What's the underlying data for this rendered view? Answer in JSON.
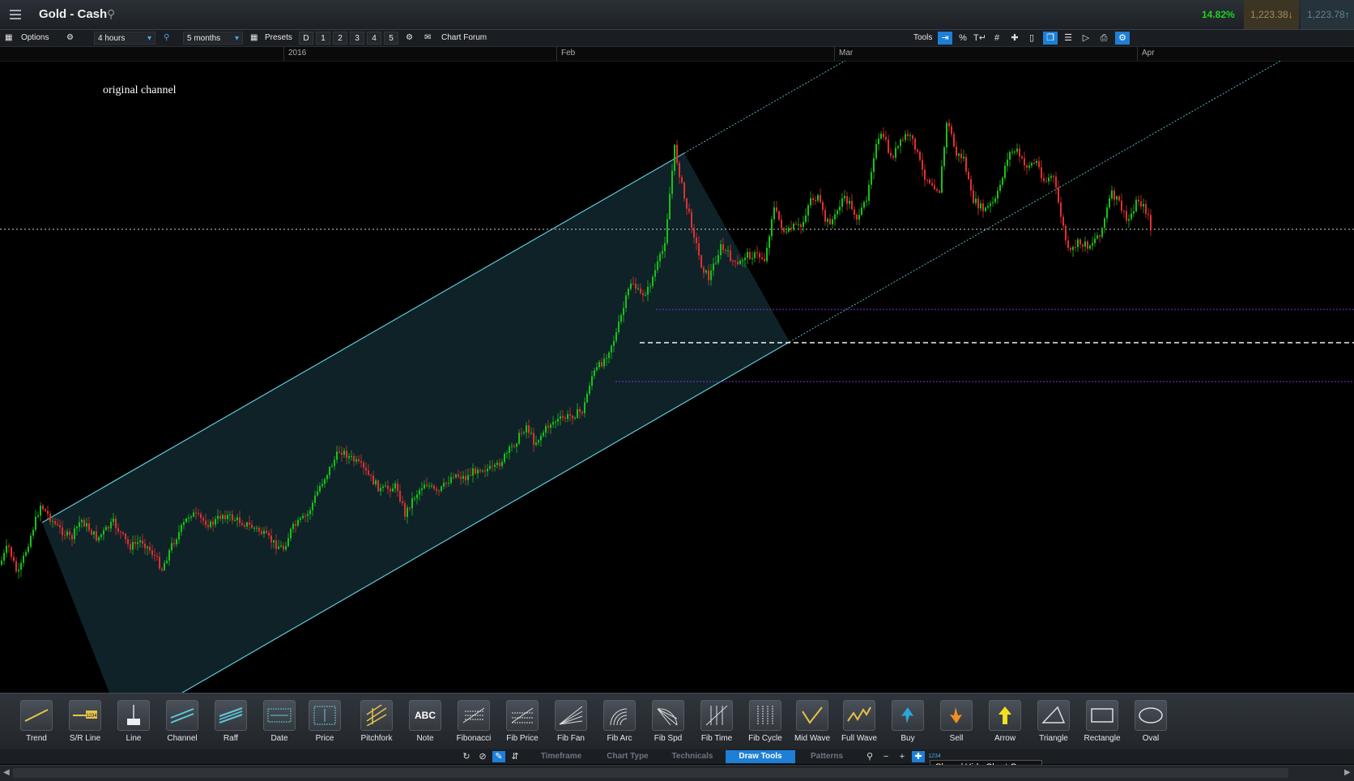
{
  "header": {
    "title": "Gold - Cash",
    "change_pct": "14.82%",
    "sell_price": "1,223.38",
    "buy_price": "1,223.78"
  },
  "toolbar": {
    "options_label": "Options",
    "interval": "4 hours",
    "range": "5 months",
    "presets_label": "Presets",
    "presets": [
      "D",
      "1",
      "2",
      "3",
      "4",
      "5"
    ],
    "chart_forum_label": "Chart Forum",
    "tools_label": "Tools",
    "tool_icons": [
      "cursor-arrow-icon",
      "percent-icon",
      "text-size-icon",
      "grid-icon",
      "crosshair-icon",
      "candle-icon",
      "window-icon",
      "bars-icon",
      "tag-icon",
      "print-icon",
      "settings-icon"
    ]
  },
  "date_axis": {
    "labels": [
      "2016",
      "Feb",
      "Mar",
      "Apr"
    ]
  },
  "annotation": "original channel",
  "draw_tools": [
    {
      "label": "Trend",
      "icon": "trend-line-icon"
    },
    {
      "label": "S/R Line",
      "icon": "sr-line-icon"
    },
    {
      "label": "Line",
      "icon": "vertical-line-icon"
    },
    {
      "label": "Channel",
      "icon": "channel-icon"
    },
    {
      "label": "Raff",
      "icon": "raff-icon"
    },
    {
      "label": "Date",
      "icon": "date-range-icon"
    },
    {
      "label": "Price",
      "icon": "price-range-icon"
    },
    {
      "label": "Pitchfork",
      "icon": "pitchfork-icon"
    },
    {
      "label": "Note",
      "icon": "note-icon"
    },
    {
      "label": "Fibonacci",
      "icon": "fibonacci-icon"
    },
    {
      "label": "Fib Price",
      "icon": "fib-price-icon"
    },
    {
      "label": "Fib Fan",
      "icon": "fib-fan-icon"
    },
    {
      "label": "Fib Arc",
      "icon": "fib-arc-icon"
    },
    {
      "label": "Fib Spd",
      "icon": "fib-speed-icon"
    },
    {
      "label": "Fib Time",
      "icon": "fib-time-icon"
    },
    {
      "label": "Fib Cycle",
      "icon": "fib-cycle-icon"
    },
    {
      "label": "Mid Wave",
      "icon": "mid-wave-icon"
    },
    {
      "label": "Full Wave",
      "icon": "full-wave-icon"
    },
    {
      "label": "Buy",
      "icon": "buy-arrow-icon"
    },
    {
      "label": "Sell",
      "icon": "sell-arrow-icon"
    },
    {
      "label": "Arrow",
      "icon": "arrow-up-icon"
    },
    {
      "label": "Triangle",
      "icon": "triangle-icon"
    },
    {
      "label": "Rectangle",
      "icon": "rectangle-icon"
    },
    {
      "label": "Oval",
      "icon": "oval-icon"
    }
  ],
  "bottom_tabs": [
    {
      "label": "Timeframe",
      "active": false
    },
    {
      "label": "Chart Type",
      "active": false
    },
    {
      "label": "Technicals",
      "active": false
    },
    {
      "label": "Draw Tools",
      "active": true
    },
    {
      "label": "Patterns",
      "active": false
    }
  ],
  "note_icon_text": "ABC",
  "counter_icon_text": "1234",
  "tooltip": "Show / Hide Chart Cursor",
  "colors": {
    "bull_candle": "#19c119",
    "bear_candle": "#e03030",
    "channel_line": "#5ec8d8",
    "support_line": "#8a2be2",
    "active_blue": "#1d7fd6"
  }
}
